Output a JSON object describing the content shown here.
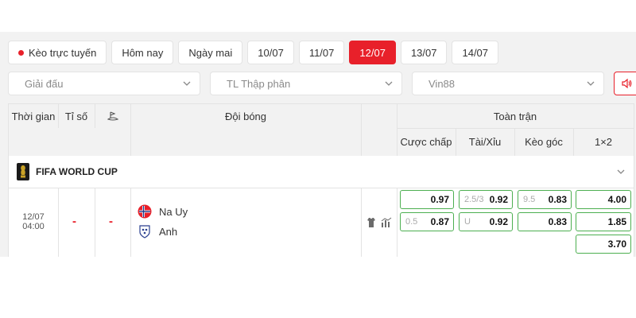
{
  "date_tabs": [
    {
      "label": "Kèo trực tuyến",
      "live": true,
      "active": false
    },
    {
      "label": "Hôm nay",
      "active": false
    },
    {
      "label": "Ngày mai",
      "active": false
    },
    {
      "label": "10/07",
      "active": false
    },
    {
      "label": "11/07",
      "active": false
    },
    {
      "label": "12/07",
      "active": true
    },
    {
      "label": "13/07",
      "active": false
    },
    {
      "label": "14/07",
      "active": false
    }
  ],
  "filters": {
    "league": "Giải đấu",
    "odds_format": "TL Thập phân",
    "bookmaker": "Vin88"
  },
  "table": {
    "headers": {
      "time": "Thời gian",
      "score": "Tỉ số",
      "teams": "Đội bóng",
      "full_match": "Toàn trận",
      "handicap": "Cược chấp",
      "over_under": "Tài/Xỉu",
      "corners": "Kèo góc",
      "one_x_two": "1×2"
    },
    "league": {
      "name": "FIFA WORLD CUP",
      "icon": "trophy-icon"
    },
    "match": {
      "date": "12/07",
      "time": "04:00",
      "score_home": "-",
      "score_away": "-",
      "home": "Na Uy",
      "away": "Anh",
      "handicap": [
        {
          "line": "",
          "value": "0.97"
        },
        {
          "line": "0.5",
          "value": "0.87"
        }
      ],
      "over_under": [
        {
          "line": "2.5/3",
          "value": "0.92"
        },
        {
          "line": "U",
          "value": "0.92"
        }
      ],
      "corners": [
        {
          "line": "9.5",
          "value": "0.83"
        },
        {
          "line": "",
          "value": "0.83"
        }
      ],
      "one_x_two": [
        "4.00",
        "1.85",
        "3.70"
      ]
    }
  },
  "colors": {
    "accent": "#e8202a",
    "odds_border": "#4caf50",
    "panel_bg": "#f2f2f2"
  }
}
